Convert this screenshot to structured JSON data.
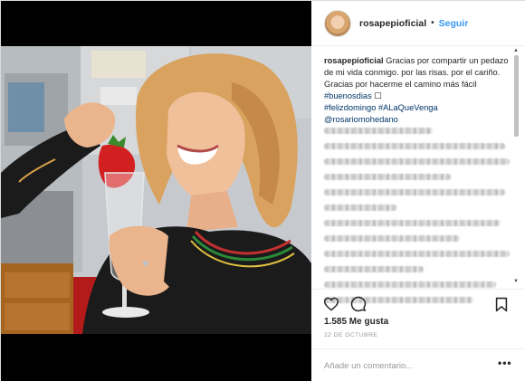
{
  "post": {
    "username": "rosapepioficial",
    "follow_label": "Seguir",
    "separator": "•",
    "caption": {
      "username": "rosapepioficial",
      "text_1": " Gracias por compartir un pedazo de mi vida conmigo. por las risas. por el cariño. Gracias por hacerme el camino más fácil ",
      "tag_1": "#buenosdias",
      "emoji": " ☐",
      "tag_2": "#felizdomingo",
      "tag_3": "#ALaQueVenga",
      "mention": "@rosariomohedano"
    },
    "likes": "1.585 Me gusta",
    "date": "22 DE OCTUBRE",
    "comment_placeholder": "Añade un comentario...",
    "more_label": "•••"
  },
  "icons": {
    "like": "heart-icon",
    "comment": "comment-bubble-icon",
    "save": "bookmark-icon"
  },
  "colors": {
    "link_blue": "#3897f0",
    "hashtag": "#003569",
    "text": "#262626",
    "muted": "#999999"
  }
}
